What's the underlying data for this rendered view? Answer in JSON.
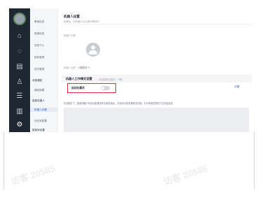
{
  "iconbar": {
    "profile_label": "机器人",
    "items": [
      {
        "icon": "home-icon",
        "glyph": "⌂"
      },
      {
        "icon": "chat-icon",
        "glyph": "◌"
      },
      {
        "icon": "document-icon",
        "glyph": "▤"
      },
      {
        "icon": "user-icon",
        "glyph": "♙"
      },
      {
        "icon": "list-icon",
        "glyph": "☰"
      },
      {
        "icon": "chart-icon",
        "glyph": "▥"
      },
      {
        "icon": "gear-icon",
        "glyph": "⚙"
      }
    ]
  },
  "menu": {
    "items": [
      {
        "label": "基础信息",
        "type": "item"
      },
      {
        "label": "渠道信息",
        "type": "item"
      },
      {
        "label": "消息卡片",
        "type": "item"
      },
      {
        "label": "授权管理",
        "type": "item"
      },
      {
        "label": "成员管理",
        "type": "item"
      },
      {
        "label": "消息通知",
        "type": "group"
      },
      {
        "label": "通知配置",
        "type": "item"
      },
      {
        "label": "智能机器人",
        "type": "group"
      },
      {
        "label": "机器人设置",
        "type": "selected"
      },
      {
        "label": "知识库配置",
        "type": "item"
      },
      {
        "label": "智能体设置",
        "type": "group"
      }
    ]
  },
  "main": {
    "title": "机器人设置",
    "subtitle": "设置后，对机器人可以操作等操作",
    "avatar_label": "机器人头像",
    "name_label": "机器人名称：",
    "name_value": "小智助手",
    "edit_icon": "✎",
    "section_title": "机器人工作模式设置",
    "section_subtitle": "(可选择默认模式，一种)",
    "mode_label": "自动化模式",
    "toggle_on": false,
    "settings_link": "设置",
    "description": "在此模式下，智能机器人可自动处理该来访者的消息，并自动分析处理相关问题，针对有用的提供下达消息信息"
  },
  "watermark": "访客 20585"
}
